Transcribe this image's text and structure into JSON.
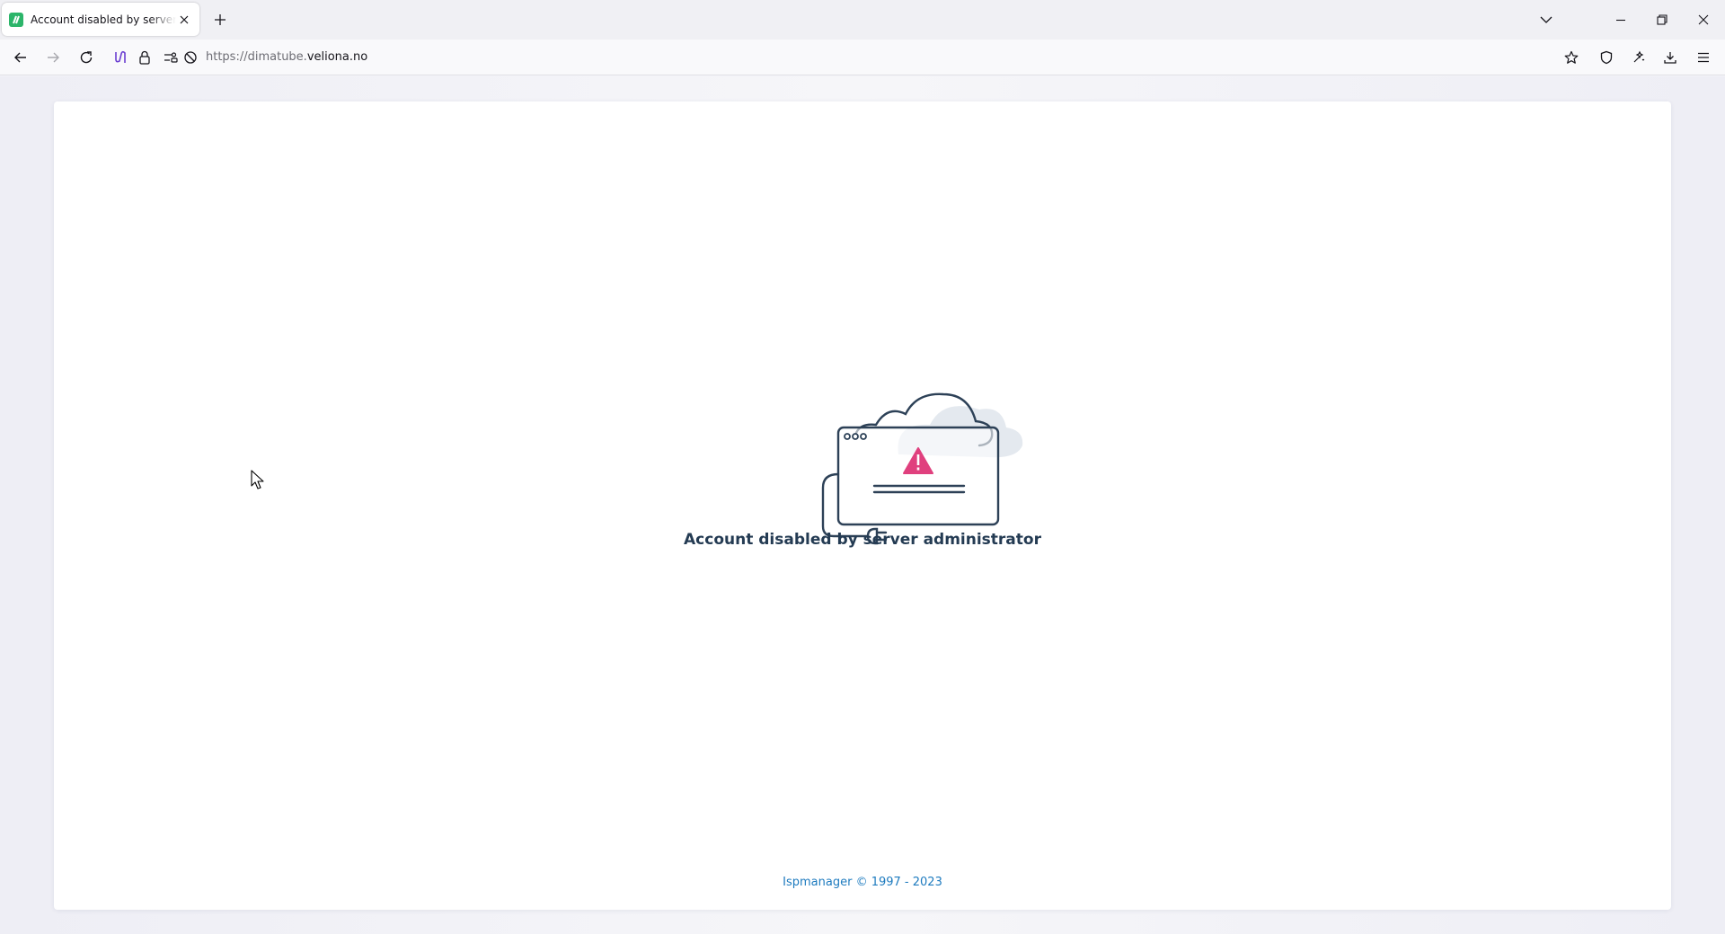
{
  "browser": {
    "tab": {
      "title": "Account disabled by server administrator",
      "favicon": "ispmanager-favicon"
    },
    "url": {
      "prefix": "https://dimatube.",
      "host": "veliona.no"
    }
  },
  "page": {
    "message": "Account disabled by server administrator",
    "footer": "Ispmanager © 1997 - 2023"
  },
  "colors": {
    "accent_link": "#1e7bbf",
    "warning": "#e0407e",
    "heading": "#243b53",
    "illustration_stroke": "#2d4157"
  }
}
